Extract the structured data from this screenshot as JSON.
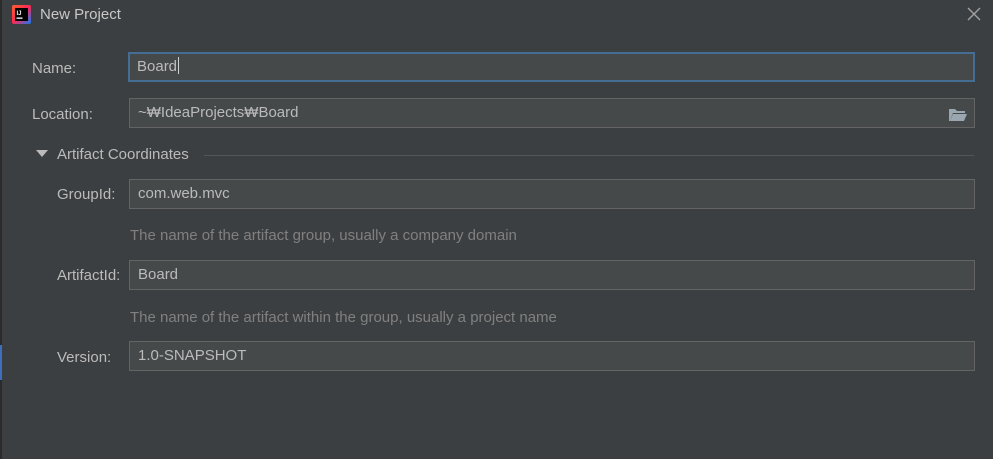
{
  "window": {
    "title": "New Project",
    "app_icon": "intellij-idea-icon",
    "close_icon": "close-icon"
  },
  "form": {
    "name_label": "Name:",
    "name_value": "Board",
    "location_label": "Location:",
    "location_value": "~₩IdeaProjects₩Board",
    "browse_icon": "folder-open-icon"
  },
  "artifact": {
    "section_title": "Artifact Coordinates",
    "expanded": true,
    "group_label": "GroupId:",
    "group_value": "com.web.mvc",
    "group_hint": "The name of the artifact group, usually a company domain",
    "artifact_label": "ArtifactId:",
    "artifact_value": "Board",
    "artifact_hint": "The name of the artifact within the group, usually a project name",
    "version_label": "Version:",
    "version_value": "1.0-SNAPSHOT"
  },
  "colors": {
    "background": "#3c3f41",
    "field_background": "#45494a",
    "focus_border": "#466d94",
    "text": "#bbbbbb",
    "hint_text": "#808080"
  }
}
